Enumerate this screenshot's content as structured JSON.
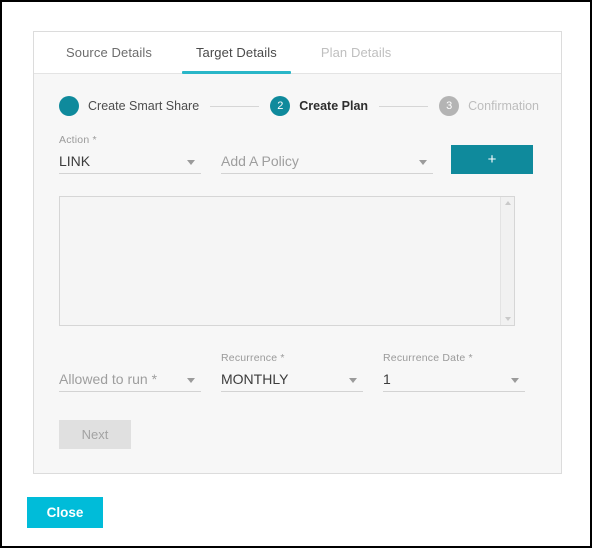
{
  "tabs": [
    {
      "label": "Source Details",
      "state": "inactive"
    },
    {
      "label": "Target Details",
      "state": "active"
    },
    {
      "label": "Plan Details",
      "state": "disabled"
    }
  ],
  "stepper": {
    "steps": [
      {
        "number": "",
        "label": "Create Smart Share",
        "state": "done"
      },
      {
        "number": "2",
        "label": "Create Plan",
        "state": "current"
      },
      {
        "number": "3",
        "label": "Confirmation",
        "state": "todo"
      }
    ]
  },
  "form": {
    "action": {
      "label": "Action *",
      "value": "LINK"
    },
    "policy": {
      "placeholder": "Add A Policy"
    },
    "add_policy_button": "+",
    "list_box": {
      "content": ""
    },
    "allowed_to_run": {
      "placeholder": "Allowed to run *"
    },
    "recurrence": {
      "label": "Recurrence *",
      "value": "MONTHLY"
    },
    "recurrence_date": {
      "label": "Recurrence Date *",
      "value": "1"
    },
    "next_button": "Next"
  },
  "footer": {
    "close_button": "Close"
  },
  "colors": {
    "teal": "#0f8a9c",
    "cyan": "#00bcd9",
    "tab_underline": "#29b6c8",
    "step_todo": "#b4b4b4"
  }
}
